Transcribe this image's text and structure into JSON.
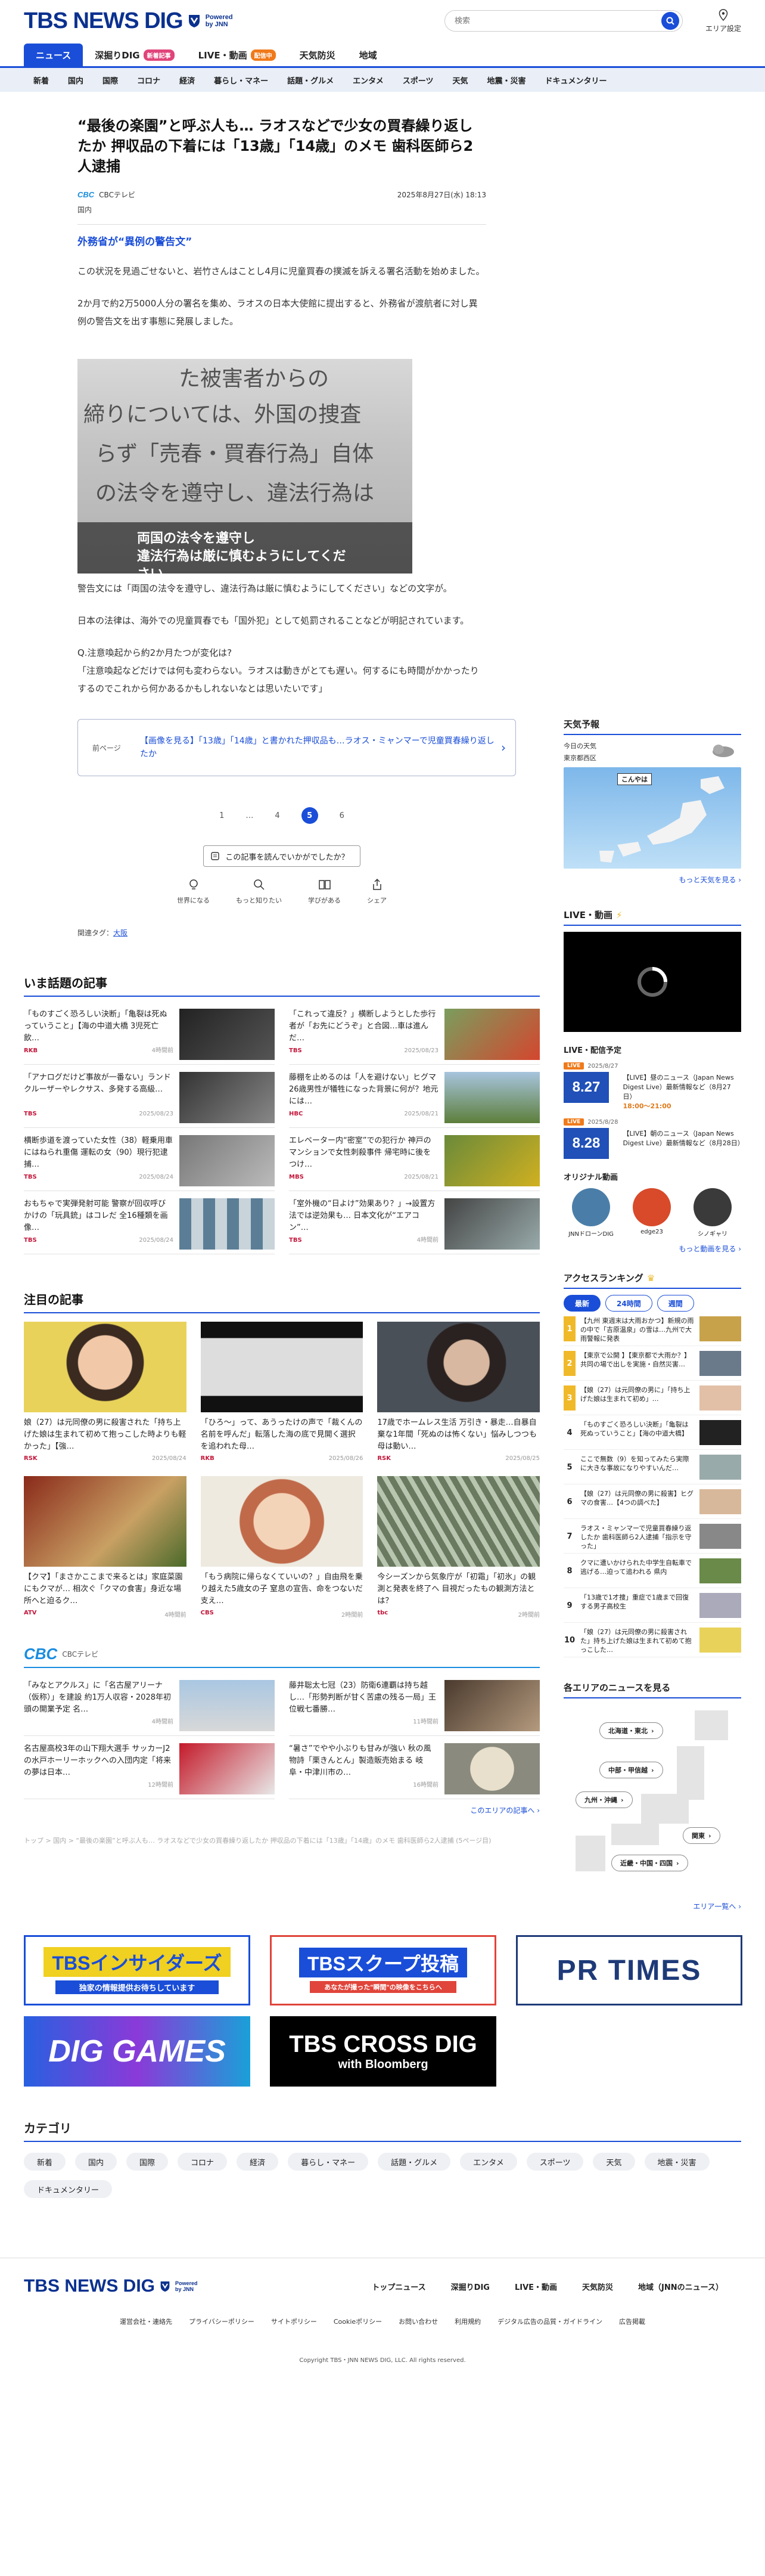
{
  "header": {
    "logo": "TBS NEWS DIG",
    "powered_1": "Powered",
    "powered_2": "by JNN",
    "search_placeholder": "検索",
    "area_label": "エリア設定"
  },
  "mainnav": [
    {
      "label": "ニュース"
    },
    {
      "label": "深掘りDIG",
      "badge": "新着記事"
    },
    {
      "label": "LIVE・動画",
      "badge": "配信中"
    },
    {
      "label": "天気防災"
    },
    {
      "label": "地域"
    }
  ],
  "subnav": [
    "新着",
    "国内",
    "国際",
    "コロナ",
    "経済",
    "暮らし・マネー",
    "話題・グルメ",
    "エンタメ",
    "スポーツ",
    "天気",
    "地震・災害",
    "ドキュメンタリー"
  ],
  "article": {
    "title": "“最後の楽園”と呼ぶ人も… ラオスなどで少女の買春繰り返したか 押収品の下着には「13歳」「14歳」のメモ 歯科医師ら2人逮捕",
    "source": "CBCテレビ",
    "source_logo": "CBC",
    "date": "2025年8月27日(水) 18:13",
    "category": "国内",
    "subhead": "外務省が“異例の警告文”",
    "p1": "この状況を見過ごせないと、岩竹さんはことし4月に児童買春の撲滅を訴える署名活動を始めました。",
    "p2": "2か月で約2万5000人分の署名を集め、ラオスの日本大使館に提出すると、外務省が渡航者に対し異例の警告文を出す事態に発展しました。",
    "photo_caption_1": "両国の法令を遵守し",
    "photo_caption_2": "違法行為は厳に慎むようにしてください",
    "photo_text_1": "た被害者からの",
    "photo_text_2": "締りについては、外国の捜査",
    "photo_text_3": "らず「売春・買春行為」自体",
    "photo_text_4": "の法令を遵守し、違法行為は",
    "p3": "警告文には「両国の法令を遵守し、違法行為は厳に慎むようにしてください」などの文字が。",
    "p4": "日本の法律は、海外での児童買春でも「国外犯」として処罰されることなどが明記されています。",
    "p5a": "Q.注意喚起から約2か月たつが変化は?",
    "p5b": "「注意喚起などだけでは何も変わらない。ラオスは動きがとても遅い。何するにも時間がかかったりするのでこれから何かあるかもしれないなとは思いたいです」",
    "prev_label": "前ページ",
    "prev_text": "【画像を見る】「13歳」「14歳」と書かれた押収品も…ラオス・ミャンマーで児童買春繰り返したか",
    "pages": [
      "1",
      "…",
      "4",
      "5",
      "6"
    ],
    "current_page": "5",
    "feedback_button": "この記事を読んでいかがでしたか？",
    "reactions": [
      "世界になる",
      "もっと知りたい",
      "学びがある",
      "シェア"
    ],
    "tags_label": "関連タグ：",
    "tag": "大阪"
  },
  "trending": {
    "title": "いま話題の記事",
    "items": [
      {
        "text": "「ものすごく恐ろしい決断」「亀裂は死ぬっていうこと」【海の中道大橋 3児死亡飲…",
        "src": "RKB",
        "date": "4時間前"
      },
      {
        "text": "「これって違反？」横断しようとした歩行者が「お先にどうぞ」と合図…車は進んだ…",
        "src": "TBS",
        "date": "2025/08/23"
      },
      {
        "text": "「アナログだけど事故が一番ない」ランドクルーザーやレクサス、多発する高級…",
        "src": "TBS",
        "date": "2025/08/23"
      },
      {
        "text": "藤棚を止めるのは「人を避けない」ヒグマ 26歳男性が犠牲になった背景に何が？地元には…",
        "src": "HBC",
        "date": "2025/08/21"
      },
      {
        "text": "横断歩道を渡っていた女性（38）軽乗用車にはねられ重傷 運転の女（90）現行犯逮捕…",
        "src": "TBS",
        "date": "2025/08/24"
      },
      {
        "text": "エレベーター内“密室”での犯行か 神戸のマンションで女性刺殺事件 帰宅時に後をつけ…",
        "src": "MBS",
        "date": "2025/08/21"
      },
      {
        "text": "おもちゃで実弾発射可能 警察が回収呼びかけの「玩具銃」はコレだ 全16種類を画像…",
        "src": "TBS",
        "date": "2025/08/24"
      },
      {
        "text": "「室外機の“日よけ”効果あり？」→設置方法では逆効果も… 日本文化が“エアコン”…",
        "src": "TBS",
        "date": "4時間前"
      }
    ]
  },
  "featured": {
    "title": "注目の記事",
    "items": [
      {
        "text": "娘（27）は元同僚の男に殺害された「持ち上げた娘は生まれて初めて抱っこした時よりも軽かった」【強…",
        "src": "RSK",
        "date": "2025/08/24"
      },
      {
        "text": "「ひろ～」って、あうったけの声で「裁くんの名前を呼んだ」転落した海の底で見開く選択を追われた母…",
        "src": "RKB",
        "date": "2025/08/26"
      },
      {
        "text": "17歳でホームレス生活 万引き・暴走…自暴自棄な1年間「死ぬのは怖くない」悩みしつつも母は動い…",
        "src": "RSK",
        "date": "2025/08/25"
      },
      {
        "text": "【クマ】「まさかここまで来るとは」家庭菜園にもクマが… 相次ぐ「クマの食害」身近な場所へと迫るク…",
        "src": "ATV",
        "date": "4時間前"
      },
      {
        "text": "「もう病院に帰らなくていいの？」自由飛を乗り越えた5歳女の子 窒息の宣告、命をつないだ支え…",
        "src": "CBS",
        "date": "2時間前"
      },
      {
        "text": "今シーズンから気象庁が「初霜」「初氷」の観測と発表を終了へ 目視だったもの観測方法とは？",
        "src": "tbc",
        "date": "2時間前"
      }
    ]
  },
  "cbc": {
    "logo": "CBC",
    "label": "CBCテレビ",
    "items": [
      {
        "text": "「みなとアクルス」に「名古屋アリーナ（仮称）」を建設 約1万人収容・2028年初頭の開業予定 名…",
        "date": "4時間前"
      },
      {
        "text": "藤井聡太七冠（23）防衛6連覇は持ち越し…「形勢判断が甘く苦慮の残る一局」王位戦七番勝…",
        "date": "11時間前"
      },
      {
        "text": "名古屋高校3年の山下翔大選手 サッカーJ2の水戸ホーリーホックへの入団内定「将来の夢は日本…",
        "date": "12時間前"
      },
      {
        "text": "“暑さ”でやや小ぶりも甘みが強い 秋の風物詩「栗きんとん」製造販売始まる 岐阜・中津川市の…",
        "date": "16時間前"
      }
    ],
    "more": "このエリアの記事へ ›"
  },
  "breadcrumb": "トップ > 国内 > “最後の楽園”と呼ぶ人も… ラオスなどで少女の買春繰り返したか 押収品の下着には「13歳」「14歳」のメモ 歯科医師ら2人逮捕 (5ページ目)",
  "sidebar": {
    "weather_title": "天気予報",
    "weather_today": "今日の天気",
    "weather_area": "東京都西区",
    "weather_map_label": "こんやは",
    "weather_more": "もっと天気を見る ›",
    "live_title": "LIVE・動画",
    "live_sched_title": "LIVE・配信予定",
    "sched": [
      {
        "tag": "LIVE",
        "date": "2025/8/27",
        "thumb": "8.27",
        "text": "【LIVE】昼のニュース（Japan News Digest Live）最新情報など（8月27日）",
        "time": "18:00～21:00"
      },
      {
        "tag": "LIVE",
        "date": "2025/8/28",
        "thumb": "8.28",
        "text": "【LIVE】朝のニュース（Japan News Digest Live）最新情報など（8月28日）",
        "time": ""
      }
    ],
    "orig_title": "オリジナル動画",
    "orig": [
      "JNNドローンDIG",
      "edge23",
      "シノギャリ"
    ],
    "live_more": "もっと動画を見る ›",
    "rank_title": "アクセスランキング",
    "rank_tabs": [
      "最新",
      "24時間",
      "週間"
    ],
    "ranks": [
      {
        "n": "1",
        "text": "【九州 東週末は大雨おかつ】新規の雨の中で「吉原温泉」の雪は…九州で大雨警報に発表",
        "top": true
      },
      {
        "n": "2",
        "text": "【東京で公開 】【東京都で大雨か？】共同の場で出しを実施・自然災害…",
        "top": true
      },
      {
        "n": "3",
        "text": "【娘（27）は元同僚の男に」「持ち上げた娘は生まれて初め」…",
        "top": true
      },
      {
        "n": "4",
        "text": "「ものすごく恐ろしい決断」「亀裂は死ぬっていうこと」【海の中道大橋】",
        "top": false
      },
      {
        "n": "5",
        "text": "ここで無数（9）を知ってみたら実際に大きな事故になりやすいんだ…",
        "top": false
      },
      {
        "n": "6",
        "text": "【娘（27）は元同僚の男に殺害】ヒグマの食害…【4つの調べた】",
        "top": false
      },
      {
        "n": "7",
        "text": "ラオス・ミャンマーで児童買春繰り返したか 歯科医師ら2人逮捕「指示を守った」",
        "top": false
      },
      {
        "n": "8",
        "text": "クマに遭いかけられた中学生自転車で逃げる…迫って追われる 県内",
        "top": false
      },
      {
        "n": "9",
        "text": "「13歳で1才捜」重症で1歳まで回復する男子高校生",
        "top": false
      },
      {
        "n": "10",
        "text": "「娘（27）は元同僚の男に殺害された」持ち上げた娘は生まれて初めて抱っこした…",
        "top": false
      }
    ],
    "area_title": "各エリアのニュースを見る",
    "areas": [
      "北海道・東北",
      "中部・甲信越",
      "九州・沖縄",
      "関東",
      "近畿・中国・四国"
    ],
    "area_more": "エリア一覧へ ›"
  },
  "banners": [
    "TBSインサイダーズ",
    "TBSスクープ投稿",
    "PR TIMES",
    "DIG GAMES",
    "TBS CROSS DIG",
    "with Bloomberg"
  ],
  "banner_sub_1": "独家の情報提供お待ちしています",
  "banner_sub_2": "あなたが撮った\"瞬間\"の映像をこちらへ",
  "category": {
    "title": "カテゴリ",
    "items": [
      "新着",
      "国内",
      "国際",
      "コロナ",
      "経済",
      "暮らし・マネー",
      "話題・グルメ",
      "エンタメ",
      "スポーツ",
      "天気",
      "地震・災害",
      "ドキュメンタリー"
    ]
  },
  "footer": {
    "logo": "TBS NEWS DIG",
    "nav": [
      "トップニュース",
      "深掘りDIG",
      "LIVE・動画",
      "天気防災",
      "地域（JNNのニュース）"
    ],
    "links": [
      "運営会社・連絡先",
      "プライバシーポリシー",
      "サイトポリシー",
      "Cookieポリシー",
      "お問い合わせ",
      "利用規約",
      "デジタル広告の品質・ガイドライン",
      "広告掲載"
    ],
    "copyright": "Copyright TBS・JNN NEWS DIG, LLC. All rights reserved."
  },
  "colors": {
    "brand": "#0b318f",
    "accent": "#1a4ed8",
    "cbc": "#1a8de0"
  }
}
